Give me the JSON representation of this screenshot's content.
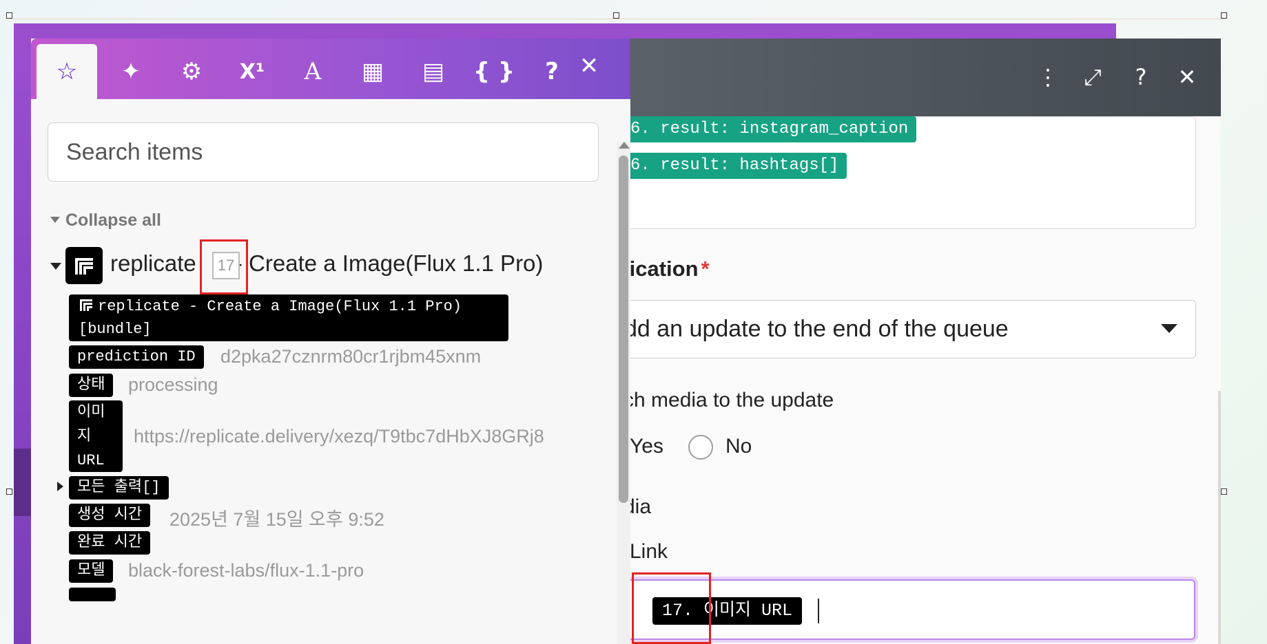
{
  "picker": {
    "tabs": [
      {
        "name": "tab-favorites",
        "glyph": "☆",
        "active": true
      },
      {
        "name": "tab-ai-functions",
        "glyph": "✦",
        "active": false
      },
      {
        "name": "tab-general-functions",
        "glyph": "⚙",
        "active": false
      },
      {
        "name": "tab-math-functions",
        "glyph": "X¹",
        "active": false
      },
      {
        "name": "tab-text-functions",
        "glyph": "A",
        "active": false
      },
      {
        "name": "tab-date-functions",
        "glyph": "▦",
        "active": false
      },
      {
        "name": "tab-array-functions",
        "glyph": "▤",
        "active": false
      },
      {
        "name": "tab-variables",
        "glyph": "{ }",
        "active": false
      }
    ],
    "help_glyph": "?",
    "close_glyph": "✕",
    "search_placeholder": "Search items",
    "collapse_all": "Collapse all",
    "module": {
      "name": "replicate",
      "number": "17",
      "title_suffix": " - Create a Image(Flux 1.1 Pro)",
      "bundle_line1": "replicate - Create a Image(Flux 1.1 Pro)",
      "bundle_line2": "[bundle]",
      "items": [
        {
          "key": "prediction ID",
          "value": "d2pka27cznrm80cr1rjbm45xnm"
        },
        {
          "key": "상태",
          "value": "processing"
        },
        {
          "key_lines": [
            "이미",
            "지",
            "URL"
          ],
          "value": "https://replicate.delivery/xezq/T9tbc7dHbXJ8GRj8"
        },
        {
          "key": "모든 출력[]",
          "value": ""
        },
        {
          "key": "생성 시간",
          "value": "2025년 7월 15일 오후 9:52"
        },
        {
          "key": "완료 시간",
          "value": ""
        },
        {
          "key": "모델",
          "value": "black-forest-labs/flux-1.1-pro"
        }
      ]
    }
  },
  "module_panel": {
    "header_icons": [
      "more-vertical-icon",
      "expand-icon",
      "help-icon",
      "close-icon"
    ],
    "text_tokens": [
      "6. result: instagram_caption",
      "6. result: hashtags[]"
    ],
    "application_label": "lication",
    "required_marker": "*",
    "application_value": "dd an update to the end of the queue",
    "attach_media_label": "ch media to the update",
    "radio_yes": "Yes",
    "radio_no": "No",
    "media_label": "dia",
    "link_label": "Link",
    "link_token": "17. 이미지 URL"
  },
  "colors": {
    "tab_gradient_start": "#c258cf",
    "tab_gradient_end": "#7d4fcb",
    "active_tab_icon": "#5a22c8",
    "token_green": "#17a283",
    "highlight_red": "#e32222",
    "link_focus": "#b985e6"
  }
}
